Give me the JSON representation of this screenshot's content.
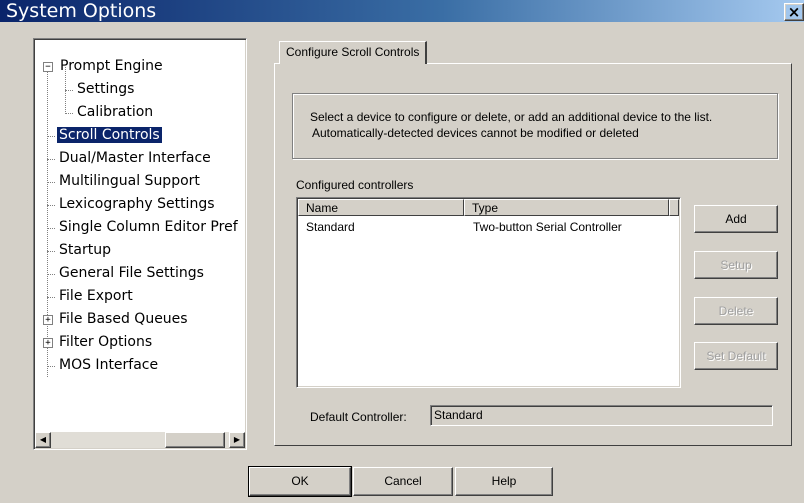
{
  "window": {
    "title": "System Options",
    "close_glyph": "×"
  },
  "tree": {
    "items": [
      {
        "label": "Prompt Engine",
        "expander": "−"
      },
      {
        "label": "Settings"
      },
      {
        "label": "Calibration"
      },
      {
        "label": "Scroll Controls",
        "selected": true
      },
      {
        "label": "Dual/Master Interface"
      },
      {
        "label": "Multilingual Support"
      },
      {
        "label": "Lexicography Settings"
      },
      {
        "label": "Single Column Editor Pref"
      },
      {
        "label": "Startup"
      },
      {
        "label": "General File Settings"
      },
      {
        "label": "File Export"
      },
      {
        "label": "File Based Queues",
        "expander": "+"
      },
      {
        "label": "Filter Options",
        "expander": "+"
      },
      {
        "label": "MOS Interface"
      }
    ]
  },
  "scrollbar": {
    "left_glyph": "◀",
    "right_glyph": "▶"
  },
  "tab": {
    "label": "Configure Scroll Controls"
  },
  "info": {
    "line1": "Select a device to configure or delete, or add an additional device to the list.",
    "line2": "Automatically-detected devices cannot be modified or deleted"
  },
  "controllers": {
    "label": "Configured controllers",
    "columns": [
      "Name",
      "Type"
    ],
    "rows": [
      [
        "Standard",
        "Two-button Serial Controller"
      ]
    ]
  },
  "side_buttons": {
    "add": "Add",
    "setup": "Setup",
    "delete": "Delete",
    "set_default": "Set Default"
  },
  "default_controller": {
    "label": "Default Controller:",
    "value": "Standard"
  },
  "footer": {
    "ok": "OK",
    "cancel": "Cancel",
    "help": "Help"
  },
  "colors": {
    "title_start": "#0a246a",
    "title_end": "#a6caf0",
    "selection": "#0a246a",
    "face": "#d4d0c8"
  }
}
